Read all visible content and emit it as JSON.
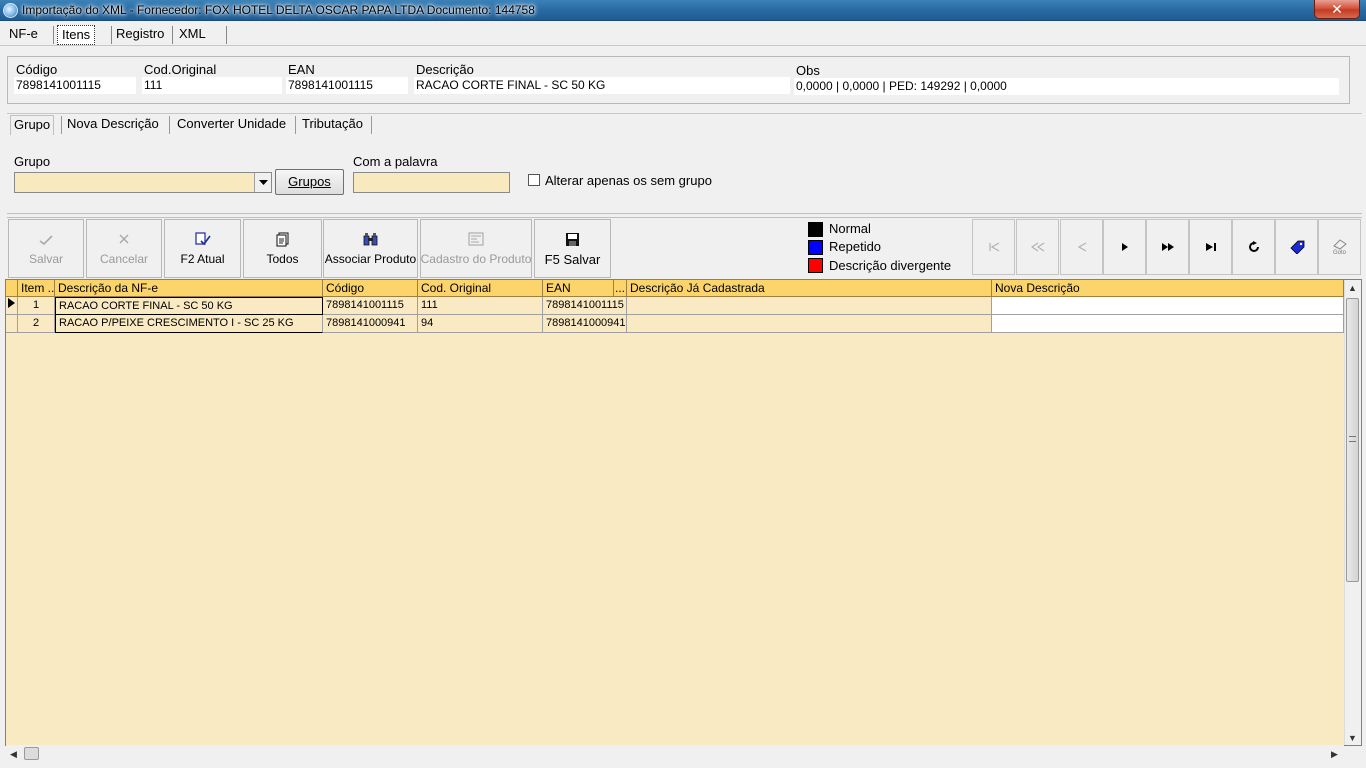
{
  "window": {
    "title": "Importação do XML - Fornecedor: FOX HOTEL DELTA OSCAR PAPA LTDA Documento: 144758",
    "close_label": "✕"
  },
  "top_tabs": [
    "NF-e",
    "Itens",
    "Registro",
    "XML"
  ],
  "header": {
    "codigo_label": "Código",
    "codigo_value": "7898141001115",
    "cod_original_label": "Cod.Original",
    "cod_original_value": "111",
    "ean_label": "EAN",
    "ean_value": "7898141001115",
    "descricao_label": "Descrição",
    "descricao_value": "RACAO CORTE FINAL - SC 50 KG",
    "obs_label": "Obs",
    "obs_value": "0,0000 | 0,0000 | PED: 149292 | 0,0000"
  },
  "sub_tabs": [
    "Grupo",
    "Nova Descrição",
    "Converter Unidade",
    "Tributação"
  ],
  "group": {
    "grupo_label": "Grupo",
    "grupo_value": "",
    "grupos_button": "Grupos",
    "palavra_label": "Com a palavra",
    "palavra_value": "",
    "checkbox_label": "Alterar apenas os sem grupo"
  },
  "toolbar": {
    "salvar": "Salvar",
    "cancelar": "Cancelar",
    "f2_atual": "F2 Atual",
    "todos": "Todos",
    "associar": "Associar Produto",
    "cadastro": "Cadastro do Produto",
    "f5_salvar": "F5 Salvar",
    "goto_label": "Goto"
  },
  "legend": [
    {
      "label": "Normal",
      "color": "#000000"
    },
    {
      "label": "Repetido",
      "color": "#0000ff"
    },
    {
      "label": "Descrição divergente",
      "color": "#ff0000"
    }
  ],
  "grid": {
    "columns": [
      "Item ...",
      "Descrição da NF-e",
      "Código",
      "Cod. Original",
      "EAN",
      "...",
      "Descrição Já Cadastrada",
      "Nova Descrição"
    ],
    "rows": [
      {
        "item": "1",
        "descricao": "RACAO CORTE FINAL - SC 50 KG",
        "codigo": "7898141001115",
        "cod_original": "111",
        "ean": "7898141001115",
        "ja_cadastrada": "",
        "nova": ""
      },
      {
        "item": "2",
        "descricao": "RACAO P/PEIXE CRESCIMENTO I - SC 25 KG",
        "codigo": "7898141000941",
        "cod_original": "94",
        "ean": "7898141000941",
        "ja_cadastrada": "",
        "nova": ""
      }
    ]
  },
  "colors": {
    "grid_bg": "#f9eac3",
    "grid_header": "#fbd46c",
    "input_bg": "#f9e9bf"
  }
}
